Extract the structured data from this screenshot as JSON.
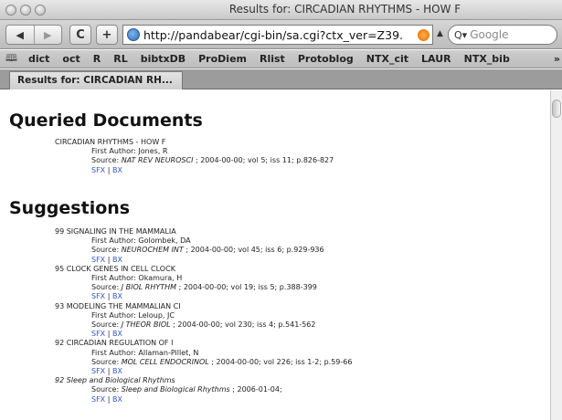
{
  "window": {
    "title": "Results for: CIRCADIAN RHYTHMS - HOW F"
  },
  "toolbar": {
    "back_label": "◀",
    "forward_label": "▶",
    "reload_label": "C",
    "add_label": "+",
    "url": "http://pandabear/cgi-bin/sa.cgi?ctx_ver=Z39.",
    "search_placeholder": "Google"
  },
  "bookmarks": {
    "items": [
      "dict",
      "oct",
      "R",
      "RL",
      "bibtxDB",
      "ProDiem",
      "Rlist",
      "Protoblog",
      "NTX_cit",
      "LAUR",
      "NTX_bib"
    ],
    "more": "»"
  },
  "tab": {
    "label": "Results for: CIRCADIAN RH..."
  },
  "page": {
    "queried_heading": "Queried Documents",
    "suggestions_heading": "Suggestions",
    "queried": {
      "title": "CIRCADIAN RHYTHMS - HOW F",
      "author": "First Author: Jones, R",
      "source_prefix": "Source: ",
      "journal": "NAT REV NEUROSCI",
      "source_rest": " ; 2004-00-00; vol 5; iss 11; p.826-827",
      "sfx": "SFX",
      "sep": " | ",
      "bx": "BX"
    },
    "suggestions": [
      {
        "title": "99 SIGNALING IN THE MAMMALIA",
        "author": "First Author: Golombek, DA",
        "journal": "NEUROCHEM INT",
        "source_rest": " ; 2004-00-00; vol 45; iss 6; p.929-936"
      },
      {
        "title": "95 CLOCK GENES IN CELL CLOCK",
        "author": "First Author: Okamura, H",
        "journal": "J BIOL RHYTHM",
        "source_rest": " ; 2004-00-00; vol 19; iss 5; p.388-399"
      },
      {
        "title": "93 MODELING THE MAMMALIAN CI",
        "author": "First Author: Leloup, JC",
        "journal": "J THEOR BIOL",
        "source_rest": " ; 2004-00-00; vol 230; iss 4; p.541-562"
      },
      {
        "title": "92 CIRCADIAN REGULATION OF I",
        "author": "First Author: Allaman-Pillet, N",
        "journal": "MOL CELL ENDOCRINOL",
        "source_rest": " ; 2004-00-00; vol 226; iss 1-2; p.59-66"
      },
      {
        "title": "92 Sleep and Biological Rhythms",
        "author": "",
        "journal": "Sleep and Biological Rhythms",
        "source_rest": " ; 2006-01-04;"
      }
    ],
    "source_prefix": "Source: ",
    "sfx": "SFX",
    "sep": " | ",
    "bx": "BX"
  }
}
